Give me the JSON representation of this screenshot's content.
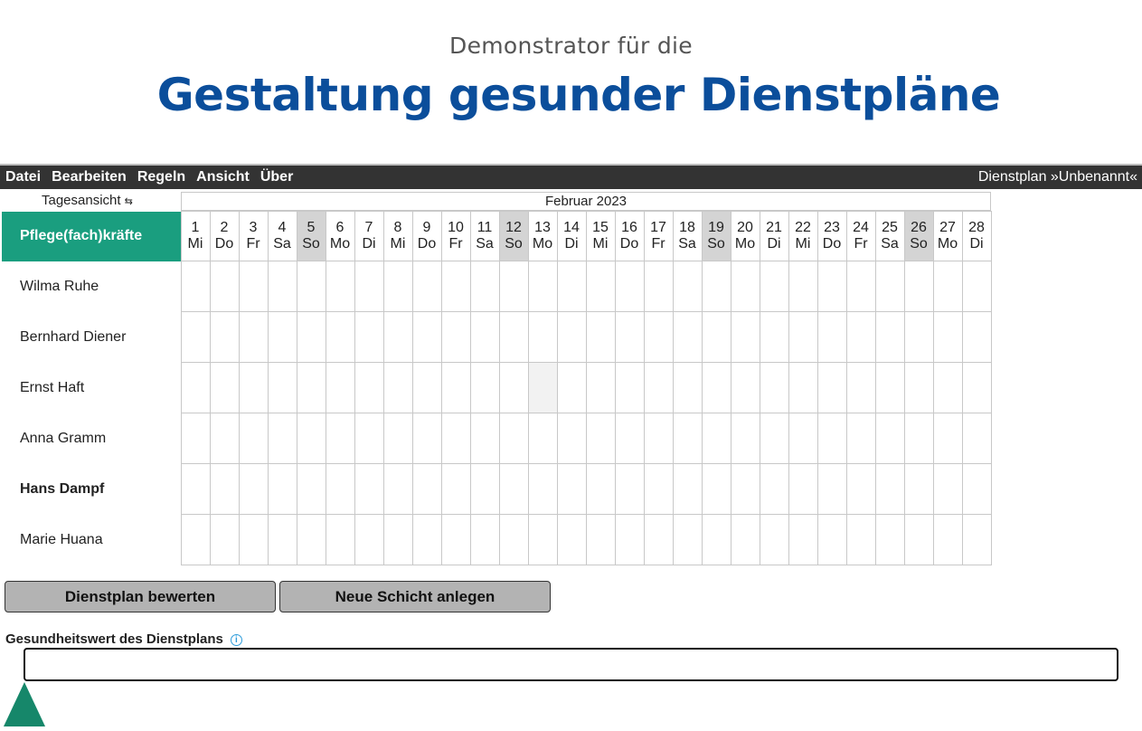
{
  "header": {
    "subtitle": "Demonstrator für die",
    "title": "Gestaltung gesunder Dienstpläne"
  },
  "menu": {
    "items": [
      "Datei",
      "Bearbeiten",
      "Regeln",
      "Ansicht",
      "Über"
    ],
    "plan_name": "Dienstplan »Unbenannt«"
  },
  "view_toggle": {
    "label": "Tagesansicht",
    "icon": "⇆"
  },
  "calendar": {
    "month": "Februar 2023",
    "column_header": "Pflege(fach)kräfte",
    "days": [
      {
        "n": "1",
        "w": "Mi"
      },
      {
        "n": "2",
        "w": "Do"
      },
      {
        "n": "3",
        "w": "Fr"
      },
      {
        "n": "4",
        "w": "Sa"
      },
      {
        "n": "5",
        "w": "So"
      },
      {
        "n": "6",
        "w": "Mo"
      },
      {
        "n": "7",
        "w": "Di"
      },
      {
        "n": "8",
        "w": "Mi"
      },
      {
        "n": "9",
        "w": "Do"
      },
      {
        "n": "10",
        "w": "Fr"
      },
      {
        "n": "11",
        "w": "Sa"
      },
      {
        "n": "12",
        "w": "So"
      },
      {
        "n": "13",
        "w": "Mo"
      },
      {
        "n": "14",
        "w": "Di"
      },
      {
        "n": "15",
        "w": "Mi"
      },
      {
        "n": "16",
        "w": "Do"
      },
      {
        "n": "17",
        "w": "Fr"
      },
      {
        "n": "18",
        "w": "Sa"
      },
      {
        "n": "19",
        "w": "So"
      },
      {
        "n": "20",
        "w": "Mo"
      },
      {
        "n": "21",
        "w": "Di"
      },
      {
        "n": "22",
        "w": "Mi"
      },
      {
        "n": "23",
        "w": "Do"
      },
      {
        "n": "24",
        "w": "Fr"
      },
      {
        "n": "25",
        "w": "Sa"
      },
      {
        "n": "26",
        "w": "So"
      },
      {
        "n": "27",
        "w": "Mo"
      },
      {
        "n": "28",
        "w": "Di"
      }
    ],
    "staff": [
      {
        "name": "Wilma Ruhe",
        "bold": false
      },
      {
        "name": "Bernhard Diener",
        "bold": false
      },
      {
        "name": "Ernst Haft",
        "bold": false
      },
      {
        "name": "Anna Gramm",
        "bold": false
      },
      {
        "name": "Hans Dampf",
        "bold": true
      },
      {
        "name": "Marie Huana",
        "bold": false
      }
    ],
    "highlighted_cell": {
      "staff": "Ernst Haft",
      "day": "13"
    }
  },
  "buttons": {
    "evaluate": "Dienstplan bewerten",
    "new_shift": "Neue Schicht anlegen"
  },
  "score": {
    "label": "Gesundheitswert des Dienstplans",
    "info_icon": "i",
    "value": ""
  },
  "colors": {
    "title": "#0b4e9b",
    "accent_green": "#1a9e7f",
    "menubar": "#333333",
    "weekend": "#d4d4d4",
    "button": "#b3b3b3"
  }
}
